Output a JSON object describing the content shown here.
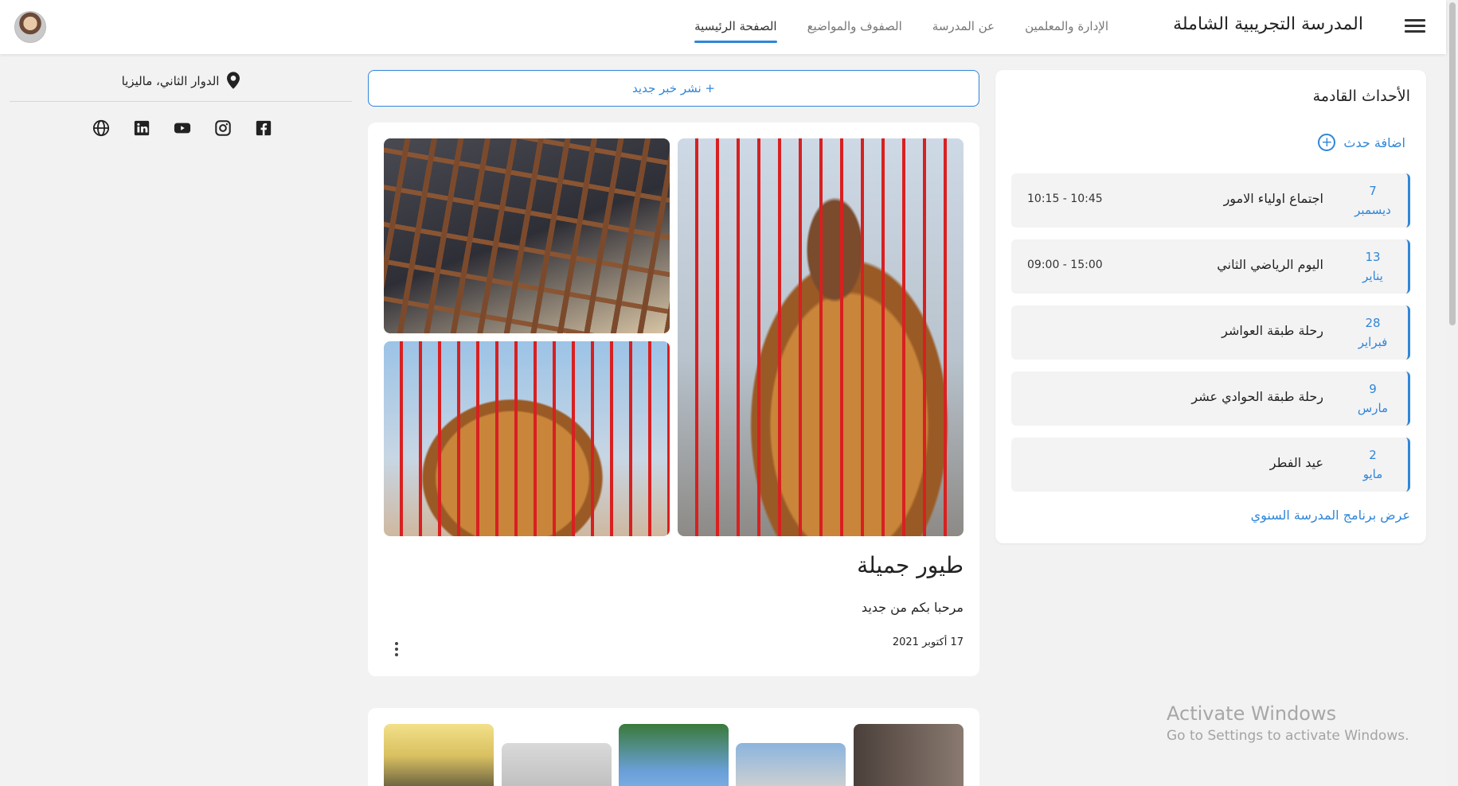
{
  "header": {
    "brand": "المدرسة التجريبية الشاملة",
    "nav": [
      {
        "label": "الصفحة الرئيسية",
        "active": true
      },
      {
        "label": "الصفوف والمواضيع",
        "active": false
      },
      {
        "label": "عن المدرسة",
        "active": false
      },
      {
        "label": "الإدارة والمعلمين",
        "active": false
      }
    ]
  },
  "events_panel": {
    "title": "الأحداث القادمة",
    "add_label": "اضافة حدث",
    "events": [
      {
        "day": "7",
        "month": "ديسمبر",
        "name": "اجتماع اولياء الامور",
        "time": "10:15 - 10:45"
      },
      {
        "day": "13",
        "month": "يناير",
        "name": "اليوم الرياضي الثاني",
        "time": "09:00 - 15:00"
      },
      {
        "day": "28",
        "month": "فبراير",
        "name": "رحلة طبقة العواشر",
        "time": ""
      },
      {
        "day": "9",
        "month": "مارس",
        "name": "رحلة طبقة الحوادي عشر",
        "time": ""
      },
      {
        "day": "2",
        "month": "مايو",
        "name": "عيد الفطر",
        "time": ""
      }
    ],
    "annual_link": "عرض برنامج المدرسة السنوي"
  },
  "feed": {
    "post_button": "+ نشر خبر جديد",
    "post": {
      "title": "طيور جميلة",
      "body": "مرحبا بكم من جديد",
      "date": "17 أكتوبر 2021"
    }
  },
  "sidebar": {
    "location": "الدوار الثاني، ماليزيا",
    "socials": [
      "facebook-icon",
      "instagram-icon",
      "youtube-icon",
      "linkedin-icon",
      "globe-icon"
    ]
  },
  "watermark": {
    "line1": "Activate Windows",
    "line2": "Go to Settings to activate Windows."
  },
  "colors": {
    "accent": "#2f86d9",
    "background": "#f2f2f3"
  }
}
